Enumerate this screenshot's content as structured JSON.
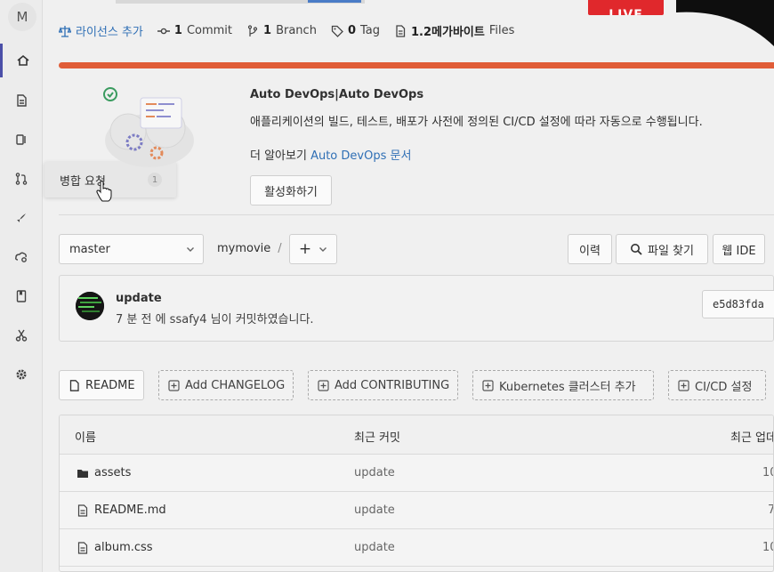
{
  "sidebar": {
    "avatar_letter": "M",
    "items": [
      {
        "icon": "home-icon"
      },
      {
        "icon": "file-icon"
      },
      {
        "icon": "issues-icon"
      },
      {
        "icon": "merge-request-icon"
      },
      {
        "icon": "rocket-icon"
      },
      {
        "icon": "cloud-settings-icon"
      },
      {
        "icon": "book-icon"
      },
      {
        "icon": "snippets-icon"
      },
      {
        "icon": "settings-icon"
      }
    ]
  },
  "flyout": {
    "label": "병합 요청",
    "count": "1"
  },
  "stats": {
    "license": "라이선스 추가",
    "commits_count": "1",
    "commits_label": "Commit",
    "branches_count": "1",
    "branches_label": "Branch",
    "tags_count": "0",
    "tags_label": "Tag",
    "files_size": "1.2메가바이트",
    "files_label": "Files"
  },
  "live_badge": "LIVE",
  "devops": {
    "title": "Auto DevOps|Auto DevOps",
    "description": "애플리케이션의 빌드, 테스트, 배포가 사전에 정의된 CI/CD 설정에 따라 자동으로 수행됩니다.",
    "more_prefix": "더 알아보기",
    "more_link": "Auto DevOps 문서",
    "enable_button": "활성화하기"
  },
  "repo_bar": {
    "branch": "master",
    "project": "mymovie",
    "separator": "/",
    "add_button": "+",
    "history_button": "이력",
    "find_file_button": "파일 찾기",
    "web_ide_button": "웹 IDE"
  },
  "commit": {
    "title": "update",
    "meta": "7 분 전 에 ssafy4 님이 커밋하였습니다.",
    "sha": "e5d83fda"
  },
  "actions": {
    "readme": "README",
    "changelog": "Add CHANGELOG",
    "contributing": "Add CONTRIBUTING",
    "kubernetes": "Kubernetes 클러스터 추가",
    "cicd": "CI/CD 설정"
  },
  "files": {
    "headers": {
      "name": "이름",
      "last_commit": "최근 커밋",
      "last_update": "최근 업데"
    },
    "rows": [
      {
        "name": "assets",
        "type": "folder",
        "commit": "update",
        "updated": "10"
      },
      {
        "name": "README.md",
        "type": "file",
        "commit": "update",
        "updated": "7"
      },
      {
        "name": "album.css",
        "type": "file",
        "commit": "update",
        "updated": "10"
      }
    ]
  },
  "colors": {
    "accent": "#2f6fb5",
    "progress": "#e05d38",
    "live": "#e0282c",
    "active_nav": "#4b4fa8"
  }
}
